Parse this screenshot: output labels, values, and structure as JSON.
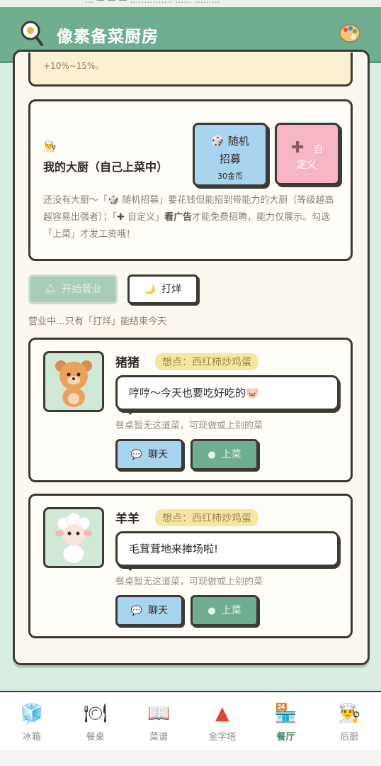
{
  "app": {
    "title": "像素备菜厨房",
    "logo_icon": "magnifier-egg-icon",
    "theme_icon": "palette-icon"
  },
  "status": {
    "text": "… — — —  …………… ……  ………"
  },
  "bonus": {
    "text": "+10%~15%。"
  },
  "chef": {
    "icon": "chef-hat-icon",
    "title": "我的大厨（自己上菜中）",
    "random_line1": "🎲  随机",
    "random_line2": "招募",
    "random_cost": "30金币",
    "custom_icon": "plus-icon",
    "custom_line1": "自",
    "custom_line2": "定义",
    "desc_part1": "还没有大厨～「🎲 随机招募」要花钱但能招到带能力的大厨（等级越高越容易出强者）；「",
    "desc_plus": "✚",
    "desc_part2": " 自定义」",
    "desc_bold": "看广告",
    "desc_part3": "才能免费招聘，能力仅展示。勾选「上菜」才发工资哦！"
  },
  "business": {
    "open_label": "开始营业",
    "open_icon": "bell-icon",
    "close_label": "打烊",
    "close_icon": "moon-icon",
    "hint": "营业中…只有「打烊」能结束今天"
  },
  "customers": [
    {
      "name": "猪猪",
      "craving": "想点：西红柿炒鸡蛋",
      "message": "哼哼～今天也要吃好吃的🐷",
      "status": "餐桌暂无这道菜，可现做或上别的菜",
      "chat_label": "聊天",
      "serve_label": "上菜",
      "avatar": "bear-avatar"
    },
    {
      "name": "羊羊",
      "craving": "想点：西红柿炒鸡蛋",
      "message": "毛茸茸地来捧场啦!",
      "status": "餐桌暂无这道菜，可现做或上别的菜",
      "chat_label": "聊天",
      "serve_label": "上菜",
      "avatar": "sheep-avatar"
    }
  ],
  "nav": [
    {
      "label": "冰箱",
      "icon": "ice-cube-icon",
      "active": false
    },
    {
      "label": "餐桌",
      "icon": "plate-icon",
      "active": false
    },
    {
      "label": "菜谱",
      "icon": "book-icon",
      "active": false
    },
    {
      "label": "金字塔",
      "icon": "pyramid-icon",
      "active": false
    },
    {
      "label": "餐厅",
      "icon": "restaurant-icon",
      "active": true
    },
    {
      "label": "后厨",
      "icon": "chef-icon",
      "active": false
    }
  ]
}
